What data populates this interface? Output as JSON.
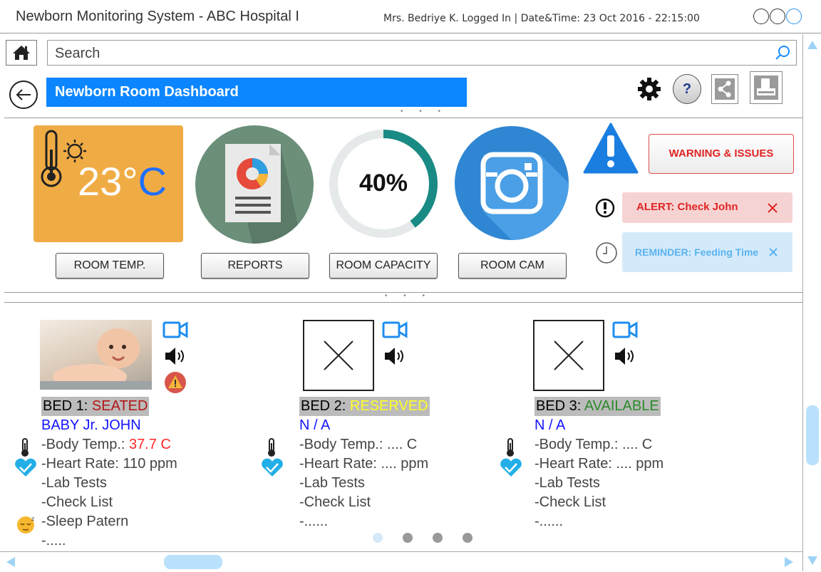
{
  "window": {
    "title": "Newborn Monitoring System - ABC Hospital I",
    "user_info": "Mrs. Bedriye K. Logged In | Date&Time: 23 Oct 2016 - 22:15:00"
  },
  "search": {
    "placeholder": "Search",
    "value": "Search"
  },
  "dashboard": {
    "title": "Newborn Room Dashboard",
    "help_label": "?"
  },
  "tiles": {
    "temperature": {
      "value": "23°C",
      "label": "ROOM TEMP."
    },
    "reports": {
      "label": "REPORTS"
    },
    "capacity": {
      "value": "40%",
      "percent": 40,
      "label": "ROOM CAPACITY"
    },
    "camera": {
      "label": "ROOM CAM"
    }
  },
  "notifications": {
    "warning_button": "WARNING & ISSUES",
    "alert": "ALERT: Check John",
    "reminder": "REMINDER: Feeding Time"
  },
  "beds": [
    {
      "heading": "BED 1: ",
      "status": "SEATED",
      "patient": "BABY Jr. JOHN",
      "body_temp_label": "-Body Temp.: ",
      "body_temp_value": "37.7 C",
      "heart_rate": "-Heart Rate: 110 ppm",
      "lab_tests": "-Lab Tests",
      "check_list": "-Check List",
      "sleep": "-Sleep Patern",
      "more": "-....."
    },
    {
      "heading": "BED 2: ",
      "status": "RESERVED",
      "patient": "N / A",
      "body_temp": "-Body Temp.: .... C",
      "heart_rate": "-Heart Rate: .... ppm",
      "lab_tests": "-Lab Tests",
      "check_list": "-Check List",
      "more": "-......"
    },
    {
      "heading": "BED 3: ",
      "status": "AVAILABLE",
      "patient": "N / A",
      "body_temp": "-Body Temp.: .... C",
      "heart_rate": "-Heart Rate: .... ppm",
      "lab_tests": "-Lab Tests",
      "check_list": "-Check List",
      "more": "-......"
    }
  ],
  "pagination": {
    "pages": 4,
    "current": 1
  },
  "colors": {
    "accent_blue": "#0c86ff",
    "temp_tile": "#f0ac44",
    "reports_tile": "#6b8f79",
    "capacity_ring": "#1a8a84",
    "camera_tile": "#2f86d2",
    "alert_red": "#e02424"
  }
}
